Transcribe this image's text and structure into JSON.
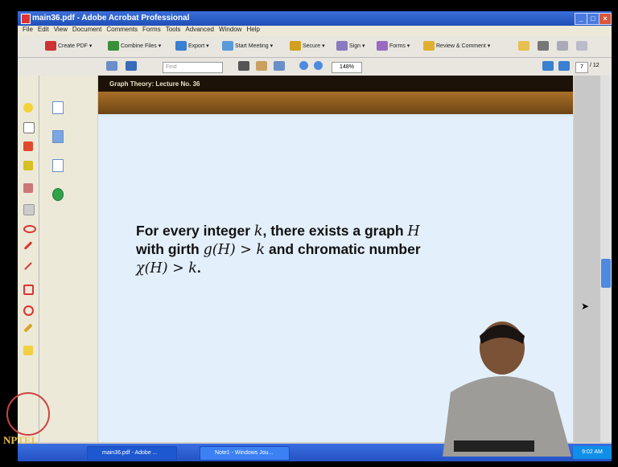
{
  "window": {
    "title": "main36.pdf - Adobe Acrobat Professional"
  },
  "menu": [
    "File",
    "Edit",
    "View",
    "Document",
    "Comments",
    "Forms",
    "Tools",
    "Advanced",
    "Window",
    "Help"
  ],
  "toolbar": {
    "buttons": [
      "Create PDF",
      "Combine Files",
      "Export",
      "Start Meeting",
      "Secure",
      "Sign",
      "Forms",
      "Review & Comment"
    ],
    "find_placeholder": "Find",
    "zoom": "148%",
    "page_current": "7",
    "page_total": "/ 12"
  },
  "document": {
    "header": "Graph Theory: Lecture No. 36",
    "theorem": {
      "line1_a": "For every integer ",
      "line1_k": "k",
      "line1_b": ", there exists a graph ",
      "line1_H": "H",
      "line2_a": "with girth ",
      "line2_g": "g(H) > k",
      "line2_b": " and chromatic number",
      "line3_chi": "χ(H) > k",
      "line3_end": "."
    }
  },
  "taskbar": {
    "tasks": [
      "main36.pdf - Adobe ...",
      "Note1 - Windows Jou..."
    ],
    "clock": "9:02 AM"
  },
  "logo": "NPTEL",
  "colors": {
    "accent": "#2452c4",
    "doc_bg": "#e3effa",
    "band": "#a96f28"
  }
}
